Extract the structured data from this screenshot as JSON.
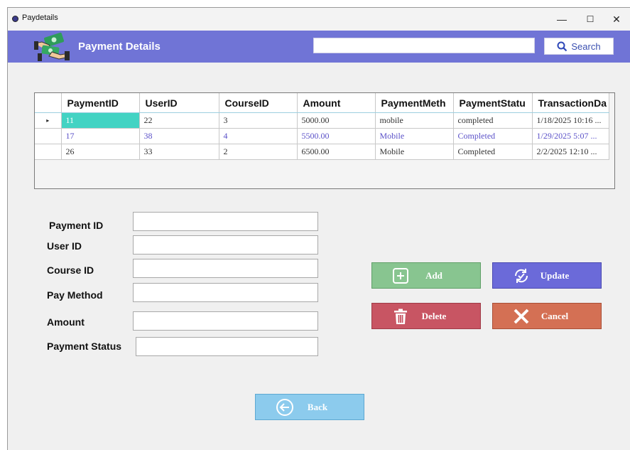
{
  "window": {
    "title": "Paydetails",
    "controls": {
      "minimize": "—",
      "maximize": "☐",
      "close": "✕"
    }
  },
  "header": {
    "title": "Payment Details",
    "search_value": "",
    "search_label": "Search"
  },
  "grid": {
    "columns": [
      "PaymentID",
      "UserID",
      "CourseID",
      "Amount",
      "PaymentMeth",
      "PaymentStatu",
      "TransactionDa"
    ],
    "current_row_marker": "▸",
    "rows": [
      [
        "11",
        "22",
        "3",
        "5000.00",
        "mobile",
        "completed",
        "1/18/2025 10:16 ..."
      ],
      [
        "17",
        "38",
        "4",
        "5500.00",
        "Mobile",
        "Completed",
        "1/29/2025 5:07 ..."
      ],
      [
        "26",
        "33",
        "2",
        "6500.00",
        "Mobile",
        "Completed",
        "2/2/2025 12:10 ..."
      ]
    ]
  },
  "form": {
    "payment_id": {
      "label": "Payment ID",
      "value": ""
    },
    "user_id": {
      "label": "User ID",
      "value": ""
    },
    "course_id": {
      "label": "Course ID",
      "value": ""
    },
    "pay_method": {
      "label": "Pay Method",
      "value": ""
    },
    "amount": {
      "label": "Amount",
      "value": ""
    },
    "payment_status": {
      "label": "Payment Status",
      "value": ""
    }
  },
  "buttons": {
    "add": "Add",
    "update": "Update",
    "delete": "Delete",
    "cancel": "Cancel",
    "back": "Back"
  },
  "colors": {
    "header": "#7074d6",
    "add": "#88c590",
    "update": "#6b6ad9",
    "delete": "#c85563",
    "cancel": "#d47054",
    "back": "#8ccbed",
    "selected_cell": "#43d3c3"
  }
}
